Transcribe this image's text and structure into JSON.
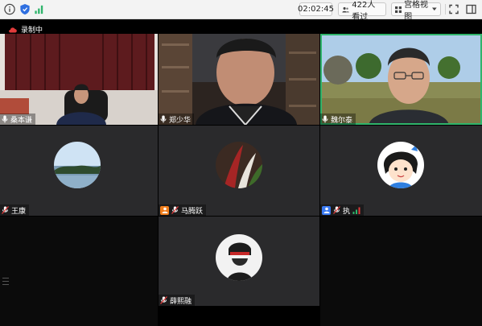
{
  "topbar": {
    "timer": "02:02:45",
    "viewers": "422人看过",
    "view_mode": "宫格视图"
  },
  "stage": {
    "recording_label": "录制中"
  },
  "colors": {
    "active_border": "#2fb46b",
    "host_badge": "#f07d1b",
    "cohost_badge": "#3a7af2",
    "tile_bg": "#2a2a2c"
  },
  "participants": [
    {
      "name": "桑本谦"
    },
    {
      "name": "郑少华"
    },
    {
      "name": "魏尔泰"
    },
    {
      "name": "王康"
    },
    {
      "name": "马腾跃"
    },
    {
      "name": "执"
    },
    {
      "name": "薛熙融"
    }
  ]
}
